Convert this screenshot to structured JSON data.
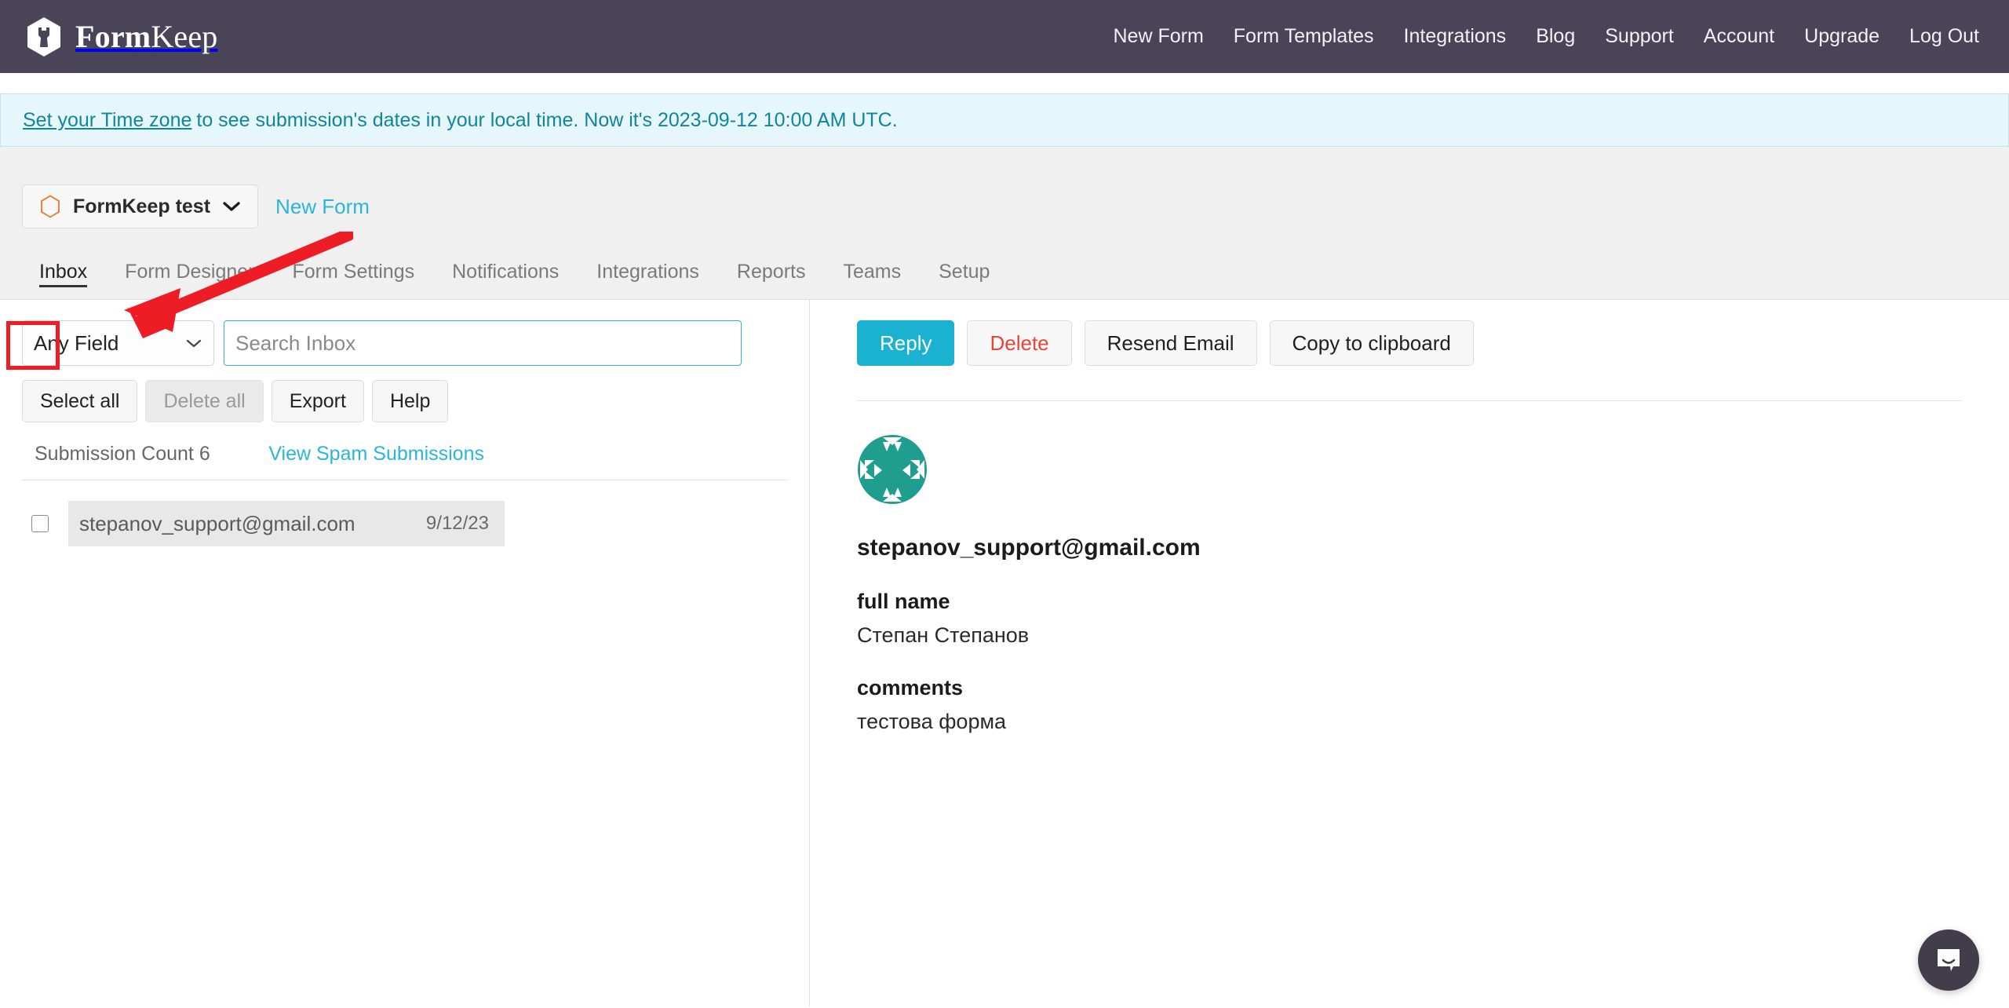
{
  "header": {
    "brand_bold": "Form",
    "brand_light": "Keep",
    "logo_icon": "formkeep-rook-logo",
    "background": "#4a4458",
    "nav": [
      {
        "label": "New Form",
        "name": "nav-new-form"
      },
      {
        "label": "Form Templates",
        "name": "nav-form-templates"
      },
      {
        "label": "Integrations",
        "name": "nav-integrations"
      },
      {
        "label": "Blog",
        "name": "nav-blog"
      },
      {
        "label": "Support",
        "name": "nav-support"
      },
      {
        "label": "Account",
        "name": "nav-account"
      },
      {
        "label": "Upgrade",
        "name": "nav-upgrade"
      },
      {
        "label": "Log Out",
        "name": "nav-log-out"
      }
    ]
  },
  "notice": {
    "link_text": "Set your Time zone",
    "body_text": "to see submission's dates in your local time. Now it's 2023-09-12 10:00 AM UTC.",
    "accent": "#11859e",
    "background": "#e6f7fb"
  },
  "form_strip": {
    "hex_icon": "hexagon-icon",
    "selected_form": "FormKeep test",
    "caret_icon": "chevron-down-icon",
    "new_form_link": "New Form",
    "link_color": "#29b6d8"
  },
  "tabs": [
    {
      "label": "Inbox",
      "active": true
    },
    {
      "label": "Form Designer",
      "active": false
    },
    {
      "label": "Form Settings",
      "active": false
    },
    {
      "label": "Notifications",
      "active": false
    },
    {
      "label": "Integrations",
      "active": false
    },
    {
      "label": "Reports",
      "active": false
    },
    {
      "label": "Teams",
      "active": false
    },
    {
      "label": "Setup",
      "active": false
    }
  ],
  "annotation": {
    "highlight_target": "Inbox",
    "color": "#ee1c25",
    "shape": "red-rectangle-and-arrow"
  },
  "inbox": {
    "field_filter": {
      "selected": "Any Field",
      "options": [
        "Any Field"
      ]
    },
    "search": {
      "placeholder": "Search Inbox",
      "value": "",
      "focused": true
    },
    "buttons": [
      {
        "label": "Select all",
        "name": "select-all-button",
        "disabled": false
      },
      {
        "label": "Delete all",
        "name": "delete-all-button",
        "disabled": true
      },
      {
        "label": "Export",
        "name": "export-button",
        "disabled": false
      },
      {
        "label": "Help",
        "name": "help-button",
        "disabled": false
      }
    ],
    "count_label": "Submission Count 6",
    "spam_link": "View Spam Submissions",
    "rows": [
      {
        "email": "stepanov_support@gmail.com",
        "date": "9/12/23",
        "selected": true,
        "checked": false
      }
    ]
  },
  "detail": {
    "actions": [
      {
        "label": "Reply",
        "name": "reply-button",
        "style": "primary"
      },
      {
        "label": "Delete",
        "name": "delete-button",
        "style": "danger"
      },
      {
        "label": "Resend Email",
        "name": "resend-email-button",
        "style": "plain"
      },
      {
        "label": "Copy to clipboard",
        "name": "copy-to-clipboard-button",
        "style": "plain"
      }
    ],
    "avatar_icon": "identicon-avatar",
    "avatar_color": "#1f9e8f",
    "email": "stepanov_support@gmail.com",
    "fields": [
      {
        "label": "full name",
        "value": "Степан Степанов"
      },
      {
        "label": "comments",
        "value": "тестова форма"
      }
    ]
  },
  "intercom": {
    "icon": "chat-bubble-icon",
    "color": "#413d4b"
  }
}
